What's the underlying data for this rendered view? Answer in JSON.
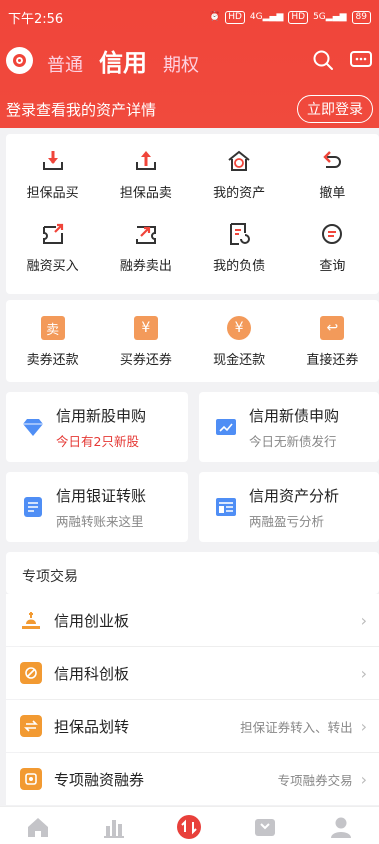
{
  "status": {
    "time": "下午2:56",
    "hd1": "HD",
    "sig1": "4G",
    "hd2": "HD",
    "sig2": "5G",
    "battery": "89"
  },
  "nav": {
    "tabs": [
      "普通",
      "信用",
      "期权"
    ],
    "active": 1
  },
  "login": {
    "text": "登录查看我的资产详情",
    "button": "立即登录"
  },
  "grid1": [
    {
      "label": "担保品买",
      "icon": "download-tray-icon"
    },
    {
      "label": "担保品卖",
      "icon": "upload-tray-icon"
    },
    {
      "label": "我的资产",
      "icon": "house-yen-icon"
    },
    {
      "label": "撤单",
      "icon": "undo-icon"
    },
    {
      "label": "融资买入",
      "icon": "margin-buy-icon"
    },
    {
      "label": "融券卖出",
      "icon": "short-sell-icon"
    },
    {
      "label": "我的负债",
      "icon": "debt-doc-icon"
    },
    {
      "label": "查询",
      "icon": "query-icon"
    }
  ],
  "grid2": [
    {
      "label": "卖券还款",
      "icon": "sell-repay-icon",
      "glyph": "卖"
    },
    {
      "label": "买券还券",
      "icon": "buy-return-icon",
      "glyph": "¥"
    },
    {
      "label": "现金还款",
      "icon": "cash-repay-icon",
      "glyph": "¥"
    },
    {
      "label": "直接还券",
      "icon": "direct-return-icon",
      "glyph": "↩"
    }
  ],
  "features": [
    {
      "title": "信用新股申购",
      "sub": "今日有2只新股",
      "icon": "diamond-icon"
    },
    {
      "title": "信用新债申购",
      "sub": "今日无新债发行",
      "icon": "bond-icon"
    },
    {
      "title": "信用银证转账",
      "sub": "两融转账来这里",
      "icon": "transfer-doc-icon"
    },
    {
      "title": "信用资产分析",
      "sub": "两融盈亏分析",
      "icon": "analysis-icon"
    }
  ],
  "special": {
    "title": "专项交易",
    "rows": [
      {
        "title": "信用创业板",
        "desc": "",
        "icon": "gem-board-icon"
      },
      {
        "title": "信用科创板",
        "desc": "",
        "icon": "star-board-icon"
      },
      {
        "title": "担保品划转",
        "desc": "担保证券转入、转出",
        "icon": "collateral-transfer-icon"
      },
      {
        "title": "专项融资融券",
        "desc": "专项融券交易",
        "icon": "special-margin-icon"
      }
    ]
  },
  "colors": {
    "brand": "#f0453a",
    "accent_orange": "#f29a32"
  }
}
